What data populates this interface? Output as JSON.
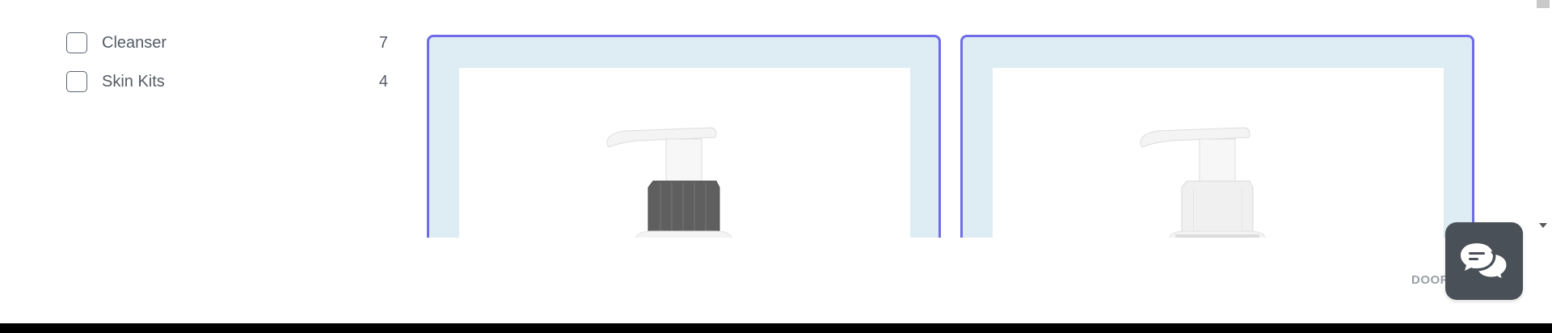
{
  "filters": [
    {
      "label": "Cleanser",
      "count": "7",
      "checked": false
    },
    {
      "label": "Skin Kits",
      "count": "4",
      "checked": false
    }
  ],
  "products": [
    {
      "image": "pump-bottle-dark-collar-image",
      "collar_color": "#5f5f5f"
    },
    {
      "image": "pump-bottle-white-collar-image",
      "collar_color": "#f0f0f0"
    }
  ],
  "chat_widget": {
    "icon": "chat-bubbles-icon",
    "brand_text": "DOOR"
  },
  "colors": {
    "card_border": "#6e6ce9",
    "card_background": "#ddedf3",
    "chat_button": "#4a5057"
  }
}
